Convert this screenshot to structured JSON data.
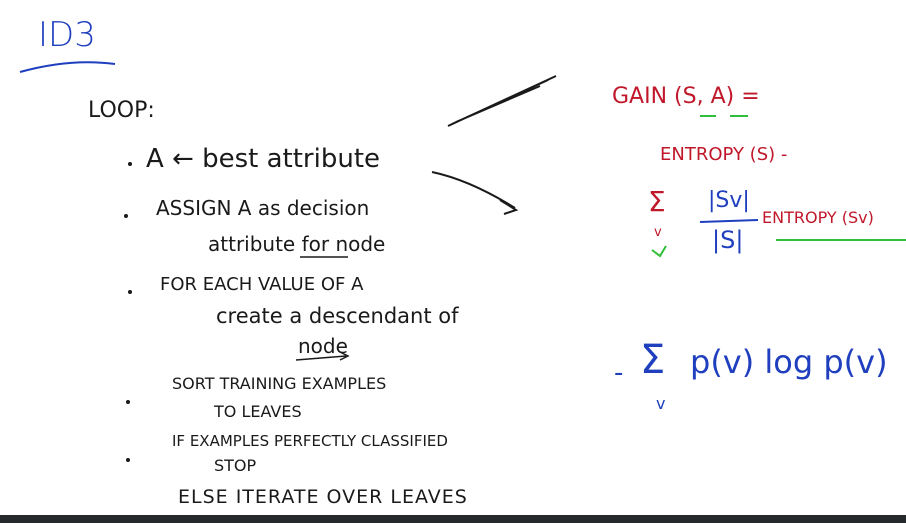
{
  "title": "ID3",
  "loop_label": "LOOP:",
  "steps": [
    {
      "lines": [
        "A ← best attribute"
      ]
    },
    {
      "lines": [
        "ASSIGN A as decision",
        "attribute for node"
      ]
    },
    {
      "lines": [
        "FOR EACH VALUE OF A",
        "create a descendant of",
        "node"
      ]
    },
    {
      "lines": [
        "SORT TRAINING EXAMPLES",
        "TO LEAVES"
      ]
    },
    {
      "lines": [
        "IF EXAMPLES PERFECTLY CLASSIFIED",
        "STOP",
        "ELSE ITERATE OVER LEAVES"
      ]
    }
  ],
  "gain_formula": {
    "lhs": "GAIN (S, A) =",
    "entropy": "ENTROPY (S) -",
    "sigma": "Σ",
    "sigma_index": "v",
    "fraction_num": "|Sv|",
    "fraction_den": "|S|",
    "entropy_sv": "ENTROPY (Sv)"
  },
  "entropy_formula": {
    "minus": "-",
    "sigma": "Σ",
    "sigma_index": "v",
    "expr": "p(v) log p(v)"
  },
  "colors": {
    "black_ink": "#1a1a1a",
    "blue_ink": "#1f3fbf",
    "red_ink": "#c0182a",
    "green_ink": "#2fbf3a"
  }
}
